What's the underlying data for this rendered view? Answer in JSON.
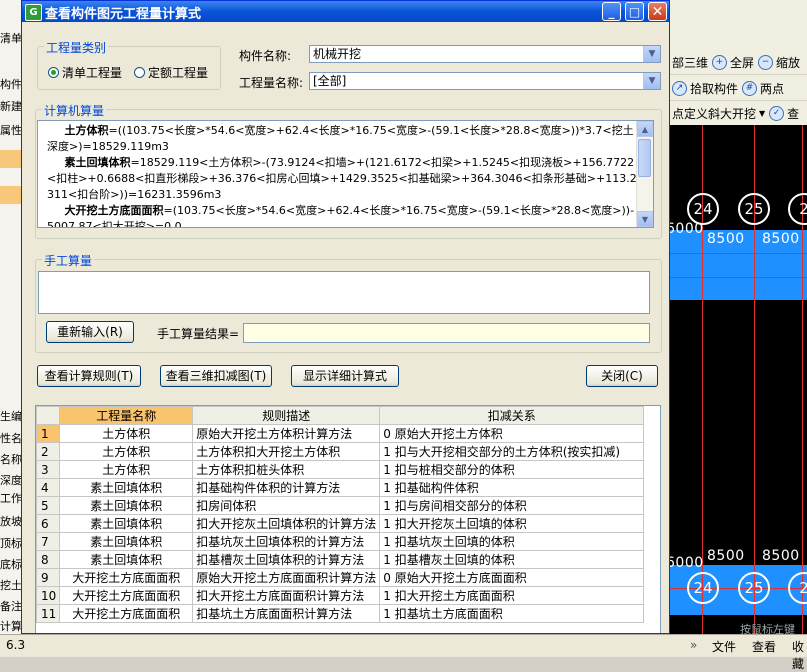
{
  "background": {
    "left_labels": [
      "清单",
      "构件列",
      "新建",
      "属性",
      "",
      "",
      "",
      "",
      "",
      "",
      "",
      "",
      "",
      "",
      "",
      "",
      "",
      "",
      "",
      "",
      "生编",
      "性名",
      "名称",
      "深度",
      "工作",
      "放坡",
      "顶标",
      "底标",
      "挖土",
      "备注",
      "计算"
    ],
    "toolbar_row1": [
      "部三维",
      "全屏",
      "缩放"
    ],
    "toolbar_row2": [
      "拾取构件",
      "两点"
    ],
    "toolbar_row3": [
      "点定义斜大开挖",
      "查"
    ],
    "axis_numbers": [
      "24",
      "25",
      "2"
    ],
    "dimension_texts": [
      "6000",
      "8500",
      "8500"
    ],
    "canvas_tip": "按鼠标左键",
    "status_left": "6.3",
    "status_right": [
      "文件",
      "查看",
      "收藏"
    ]
  },
  "dialog": {
    "title": "查看构件图元工程量计算式",
    "buttons": {
      "minimize": "_",
      "maximize": "□",
      "close": "✕"
    },
    "qty_type": {
      "group_title": "工程量类别",
      "options": [
        {
          "label": "清单工程量",
          "selected": true
        },
        {
          "label": "定额工程量",
          "selected": false
        }
      ]
    },
    "component_name_label": "构件名称:",
    "component_name_value": "机械开挖",
    "qty_name_label": "工程量名称:",
    "qty_name_value": "[全部]",
    "computer_calc": {
      "group_title": "计算机算量",
      "lines": [
        {
          "title": "土方体积",
          "text": "=((103.75<长度>*54.6<宽度>+62.4<长度>*16.75<宽度>-(59.1<长度>*28.8<宽度>))*3.7<挖土深度>)=18529.119m3"
        },
        {
          "title": "素土回填体积",
          "text": "=18529.119<土方体积>-(73.9124<扣墙>+(121.6172<扣梁>+1.5245<扣现浇板>+156.7722<扣柱>+0.6688<扣直形梯段>+36.376<扣房心回填>+1429.3525<扣基础梁>+364.3046<扣条形基础>+113.2311<扣台阶>))=16231.3596m3"
        },
        {
          "title": "大开挖土方底面面积",
          "text": "=(103.75<长度>*54.6<宽度>+62.4<长度>*16.75<宽度>-(59.1<长度>*28.8<宽度>))-5007.87<扣大开挖>=0.0"
        }
      ]
    },
    "manual_calc": {
      "group_title": "手工算量",
      "reenter_button": "重新输入(R)",
      "result_label": "手工算量结果="
    },
    "action_buttons": {
      "view_rules": "查看计算规则(T)",
      "view_3d": "查看三维扣减图(T)",
      "show_detail": "显示详细计算式",
      "close": "关闭(C)"
    },
    "table": {
      "headers": [
        "",
        "工程量名称",
        "规则描述",
        "扣减关系"
      ],
      "rows": [
        {
          "no": "1",
          "name": "土方体积",
          "rule": "原始大开挖土方体积计算方法",
          "relation": "0 原始大开挖土方体积"
        },
        {
          "no": "2",
          "name": "土方体积",
          "rule": "土方体积扣大开挖土方体积",
          "relation": "1  扣与大开挖相交部分的土方体积(按实扣减)"
        },
        {
          "no": "3",
          "name": "土方体积",
          "rule": "土方体积扣桩头体积",
          "relation": "1   扣与桩相交部分的体积"
        },
        {
          "no": "4",
          "name": "素土回填体积",
          "rule": "扣基础构件体积的计算方法",
          "relation": "1 扣基础构件体积"
        },
        {
          "no": "5",
          "name": "素土回填体积",
          "rule": "扣房间体积",
          "relation": "1  扣与房间相交部分的体积"
        },
        {
          "no": "6",
          "name": "素土回填体积",
          "rule": "扣大开挖灰土回填体积的计算方法",
          "relation": "1 扣大开挖灰土回填的体积"
        },
        {
          "no": "7",
          "name": "素土回填体积",
          "rule": "扣基坑灰土回填体积的计算方法",
          "relation": "1 扣基坑灰土回填的体积"
        },
        {
          "no": "8",
          "name": "素土回填体积",
          "rule": "扣基槽灰土回填体积的计算方法",
          "relation": "1 扣基槽灰土回填的体积"
        },
        {
          "no": "9",
          "name": "大开挖土方底面面积",
          "rule": "原始大开挖土方底面面积计算方法",
          "relation": "0 原始大开挖土方底面面积"
        },
        {
          "no": "10",
          "name": "大开挖土方底面面积",
          "rule": "扣大开挖土方底面面积计算方法",
          "relation": "1 扣大开挖土方底面面积"
        },
        {
          "no": "11",
          "name": "大开挖土方底面面积",
          "rule": "扣基坑土方底面面积计算方法",
          "relation": "1 扣基坑土方底面面积"
        }
      ]
    }
  },
  "colors": {
    "title_bar": "#0a54d8",
    "group_title": "#0046d5",
    "selected_header": "#f9c46d",
    "canvas_blue": "#1e90ff",
    "canvas_grid": "#e03030"
  }
}
